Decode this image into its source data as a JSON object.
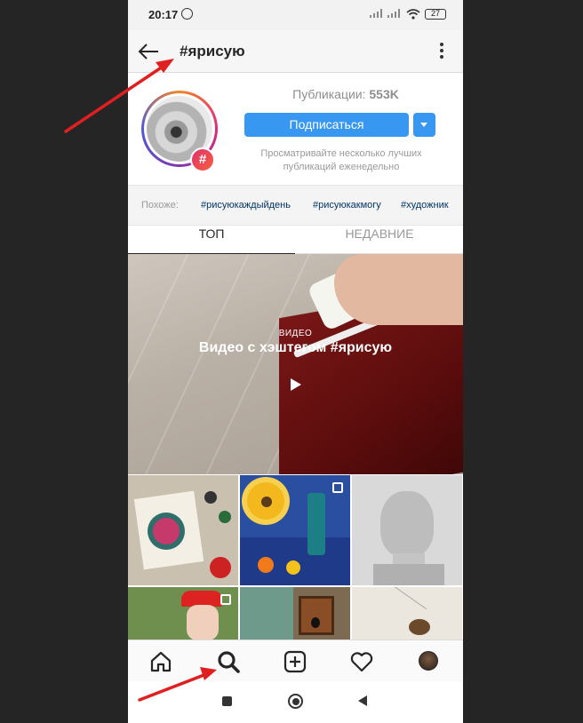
{
  "status_bar": {
    "time": "20:17",
    "battery": "27"
  },
  "header": {
    "title": "#ярисую"
  },
  "profile": {
    "posts_label": "Публикации:",
    "posts_count": "553K",
    "follow_label": "Подписаться",
    "badge": "#",
    "description": "Просматривайте несколько лучших публикаций еженедельно"
  },
  "related": {
    "label": "Похоже:",
    "tags": [
      "#рисуюкаждыйдень",
      "#рисуюкакмогу",
      "#художник"
    ]
  },
  "tabs": [
    {
      "label": "ТОП",
      "active": true
    },
    {
      "label": "НЕДАВНИЕ",
      "active": false
    }
  ],
  "video": {
    "caption": "ВИДЕО",
    "title": "Видео с хэштегом #ярисую"
  },
  "grid": [
    {
      "name": "post-thumbnail",
      "multi": false
    },
    {
      "name": "post-thumbnail",
      "multi": true
    },
    {
      "name": "post-thumbnail",
      "multi": false
    },
    {
      "name": "post-thumbnail",
      "multi": true
    },
    {
      "name": "post-thumbnail",
      "multi": false
    },
    {
      "name": "post-thumbnail",
      "multi": false
    }
  ],
  "bottom_nav": [
    "home-icon",
    "search-icon",
    "add-post-icon",
    "heart-icon",
    "profile-avatar"
  ],
  "system_nav": [
    "recents-icon",
    "home-circle-icon",
    "back-triangle-icon"
  ],
  "colors": {
    "accent": "#3897f0",
    "annotation": "#e02020",
    "link": "#003569"
  }
}
